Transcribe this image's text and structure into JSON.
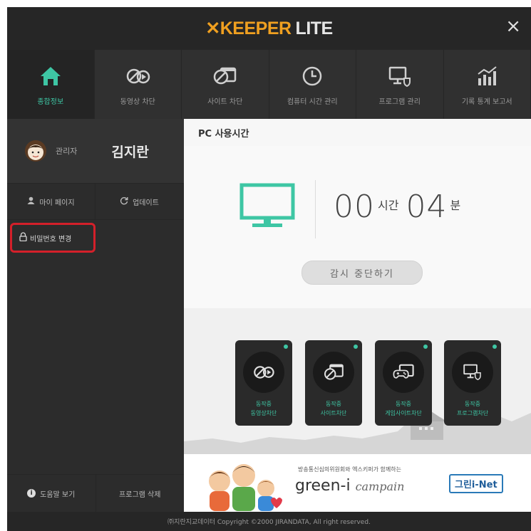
{
  "app": {
    "logo_mark": "✕",
    "logo_brand": "KEEPER",
    "logo_suffix": "LITE",
    "close_label": "×"
  },
  "nav": {
    "items": [
      {
        "label": "종합정보",
        "icon": "home-icon"
      },
      {
        "label": "동영상 차단",
        "icon": "video-block-icon"
      },
      {
        "label": "사이트 차단",
        "icon": "site-block-icon"
      },
      {
        "label": "컴퓨터 시간 관리",
        "icon": "clock-icon"
      },
      {
        "label": "프로그램 관리",
        "icon": "program-icon"
      },
      {
        "label": "기록 통계 보고서",
        "icon": "chart-icon"
      }
    ],
    "active_index": 0
  },
  "profile": {
    "role": "관리자",
    "name": "김지란"
  },
  "sidebar": {
    "mypage": "마이 페이지",
    "update": "업데이트",
    "change_password": "비밀번호 변경",
    "help": "도움말 보기",
    "remove": "프로그램 삭제"
  },
  "main": {
    "section_title": "PC 사용시간",
    "hours": "00",
    "hours_unit": "시간",
    "minutes": "04",
    "minutes_unit": "분",
    "stop_button": "감시 중단하기"
  },
  "tiles": [
    {
      "status": "동작중",
      "label": "동영상차단"
    },
    {
      "status": "동작중",
      "label": "사이트차단"
    },
    {
      "status": "동작중",
      "label": "게임사이트차단"
    },
    {
      "status": "동작중",
      "label": "프로그램차단"
    }
  ],
  "banner": {
    "subtitle": "방송통신심의위원회와 엑스키퍼가 함께하는",
    "campaign": "green-i",
    "campaign_script": "campain",
    "net_logo": "그린i-Net"
  },
  "footer": {
    "text": "㈜지란지교데이터 Copyright ©2000 JIRANDATA, All right reserved."
  },
  "colors": {
    "accent": "#3ec6a4",
    "brand_orange": "#f0a020",
    "highlight_red": "#d4202a"
  }
}
